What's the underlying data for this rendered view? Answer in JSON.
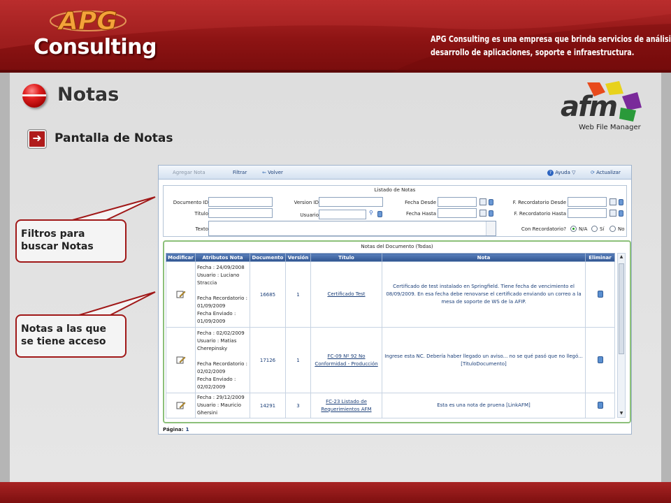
{
  "header": {
    "logo_top": "APG",
    "logo_main": "Consulting",
    "tagline_line1": "APG Consulting es una empresa que brinda servicios de análisis,",
    "tagline_line2": "desarrollo de aplicaciones, soporte e infraestructura."
  },
  "slide": {
    "title": "Notas",
    "subtitle": "Pantalla de Notas",
    "afm_logo_text": "afm",
    "afm_logo_sub": "Web File Manager",
    "callout_filters": "Filtros para buscar Notas",
    "callout_notes": "Notas a las que se tiene acceso",
    "accent_color": "#a01818"
  },
  "app": {
    "toolbar": {
      "agregar": "Agregar Nota",
      "filtrar": "Filtrar",
      "volver": "Volver",
      "ayuda": "Ayuda",
      "actualizar": "Actualizar"
    },
    "filters": {
      "caption": "Listado de Notas",
      "documento_id": "Documento ID",
      "version_id": "Version ID",
      "fecha_desde": "Fecha Desde",
      "f_recordatorio_desde": "F. Recordatorio Desde",
      "titulo": "Título",
      "usuario": "Usuario",
      "fecha_hasta": "Fecha Hasta",
      "f_recordatorio_hasta": "F. Recordatorio Hasta",
      "texto": "Texto",
      "con_recordatorio": "Con Recordatorio?",
      "opt_na": "N/A",
      "opt_si": "Sí",
      "opt_no": "No",
      "selected": "N/A"
    },
    "notes": {
      "caption": "Notas del Documento (Todas)",
      "columns": [
        "Modificar",
        "Atributos Nota",
        "Documento",
        "Versión",
        "Título",
        "Nota",
        "Eliminar"
      ],
      "rows": [
        {
          "atributos": "Fecha : 24/09/2008\nUsuario : Luciano Straccia\n\nFecha Recordatorio : 01/09/2009\nFecha Enviado : 01/09/2009",
          "documento": "16685",
          "version": "1",
          "titulo": "Certificado Test",
          "nota": "Certificado de test instalado en Springfield. Tiene fecha de vencimiento el 08/09/2009. En esa fecha debe renovarse el certificado enviando un correo a la mesa de soporte de WS de la AFIP."
        },
        {
          "atributos": "Fecha : 02/02/2009\nUsuario : Matias Cherepinsky\n\nFecha Recordatorio : 02/02/2009\nFecha Enviado : 02/02/2009",
          "documento": "17126",
          "version": "1",
          "titulo": "FC-09 Nº 92 No Conformidad - Producción",
          "nota": "Ingrese esta NC. Debería haber llegado un aviso... no se qué pasó que no llegó... [TituloDocumento]"
        },
        {
          "atributos": "Fecha : 29/12/2009\nUsuario : Mauricio Ghersini",
          "documento": "14291",
          "version": "3",
          "titulo": "FC-23 Listado de Requerimientos AFM",
          "nota": "Esta es una nota de pruena [LinkAFM]"
        }
      ]
    },
    "pager": {
      "label": "Página:",
      "current": "1"
    }
  }
}
